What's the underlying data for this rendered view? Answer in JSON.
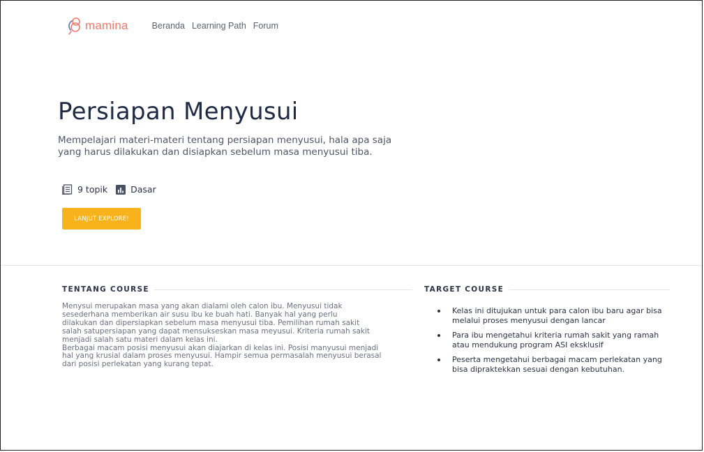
{
  "brand": {
    "name": "mamina",
    "accent_color": "#f07a6b"
  },
  "nav": {
    "links": [
      "Beranda",
      "Learning Path",
      "Forum"
    ]
  },
  "hero": {
    "title": "Persiapan Menyusui",
    "description": "Mempelajari materi-materi tentang persiapan menyusui, hala apa saja yang harus dilakukan dan disiapkan sebelum masa menyusui tiba.",
    "topics_label": "9 topik",
    "topics_icon": "book-list-icon",
    "level_label": "Dasar",
    "level_icon": "bar-chart-icon",
    "cta_label": "LANJUT EXPLORE!",
    "cta_color": "#f7b21c"
  },
  "about": {
    "title": "TENTANG COURSE",
    "text": "Menysui merupakan masa yang akan dialami oleh calon ibu. Menyusui tidak\nsesederhana memberikan air susu ibu ke buah hati. Banyak hal yang perlu\ndilakukan dan dipersiapkan sebelum masa menyusui tiba. Pemilihan rumah sakit\nsalah satupersiapan yang dapat mensukseskan masa meyusui. Kriteria rumah sakit\nmenjadi salah satu materi dalam kelas ini.\nBerbagai macam posisi menyusui akan diajarkan di kelas ini. Posisi manyusui menjadi\nhal yang krusial dalam proses menyusui. Hampir semua permasalah menyusui berasal\ndari posisi perlekatan yang kurang tepat."
  },
  "target": {
    "title": "TARGET COURSE",
    "items": [
      "Kelas ini ditujukan untuk para calon ibu baru agar bisa melalui proses menyusui dengan lancar",
      "Para ibu mengetahui kriteria rumah sakit yang ramah atau mendukung program ASI eksklusif",
      "Peserta mengetahui berbagai macam perlekatan yang bisa dipraktekkan sesuai dengan kebutuhan."
    ]
  }
}
